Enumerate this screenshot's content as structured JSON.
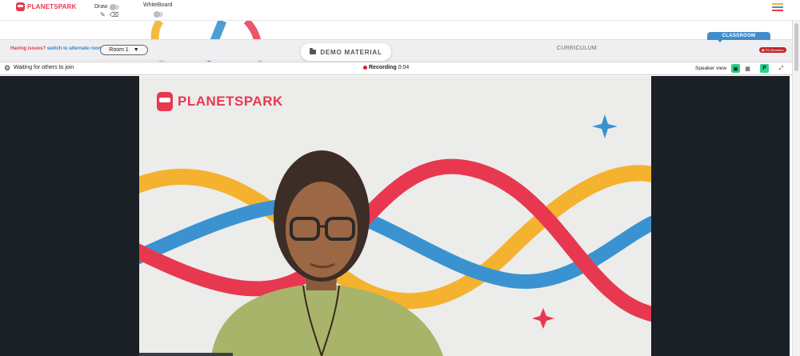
{
  "header": {
    "logo_text": "PLANETSPARK",
    "draw_label": "Draw",
    "whiteboard_label": "WhiteBoard"
  },
  "strip": {
    "issue_text": "Having issues?",
    "switch_text": "switch to alternate room",
    "room_value": "Room 1",
    "demo_material_label": "DEMO MATERIAL",
    "curriculum_label": "CURRICULUM",
    "classroom_tab_label": "CLASSROOM",
    "ps_moments_label": "PS Moments"
  },
  "meeting": {
    "waiting_text": "Waiting for others to join",
    "recording_label": "Recording",
    "recording_time": "0:04",
    "speaker_view_label": "Speaker view",
    "participant_initial": "P"
  },
  "video": {
    "background_logo_text": "PLANETSPARK"
  },
  "icons": [
    "pencil-icon",
    "eraser-icon",
    "hamburger-menu-icon",
    "folder-icon",
    "gear-icon",
    "record-dot-icon",
    "speaker-view-icon",
    "gallery-view-icon",
    "fullscreen-icon"
  ],
  "colors": {
    "brand_red": "#e8384f",
    "brand_blue": "#3f8ecb",
    "accent_green": "#29d48c",
    "wave_yellow": "#f5b22e",
    "wave_blue": "#3a93d0",
    "video_bg": "#1b2027"
  }
}
